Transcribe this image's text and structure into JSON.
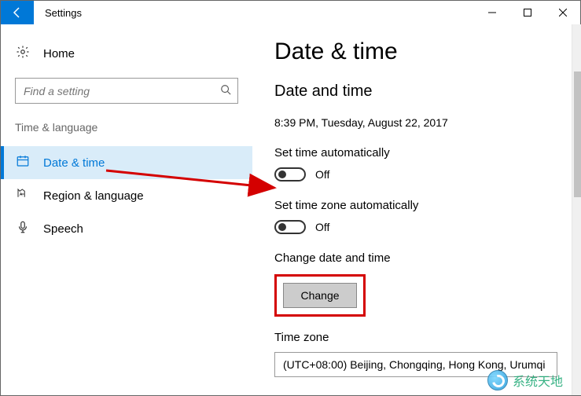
{
  "window": {
    "title": "Settings"
  },
  "sidebar": {
    "home": "Home",
    "search_placeholder": "Find a setting",
    "category": "Time & language",
    "items": [
      {
        "label": "Date & time",
        "icon": "🕒",
        "active": true
      },
      {
        "label": "Region & language",
        "icon": "🌐",
        "active": false
      },
      {
        "label": "Speech",
        "icon": "🎤",
        "active": false
      }
    ]
  },
  "content": {
    "heading": "Date & time",
    "subheading": "Date and time",
    "current_time": "8:39 PM, Tuesday, August 22, 2017",
    "auto_time_label": "Set time automatically",
    "auto_time_state": "Off",
    "auto_tz_label": "Set time zone automatically",
    "auto_tz_state": "Off",
    "change_label": "Change date and time",
    "change_button": "Change",
    "tz_label": "Time zone",
    "tz_value": "(UTC+08:00) Beijing, Chongqing, Hong Kong, Urumqi"
  },
  "watermark": "系统天地"
}
